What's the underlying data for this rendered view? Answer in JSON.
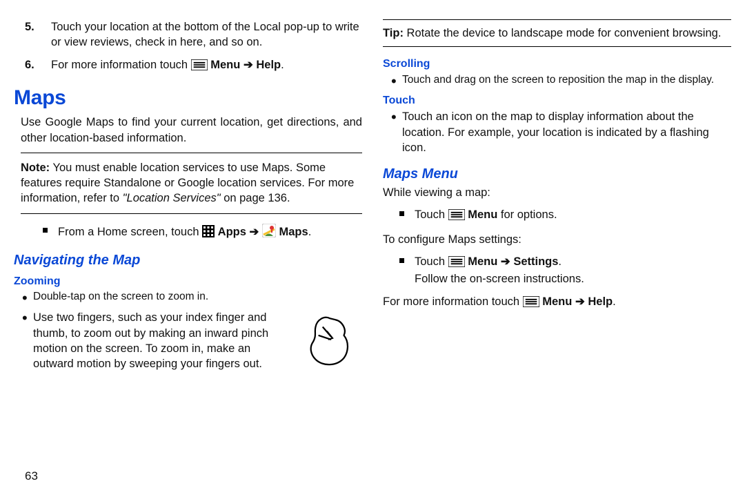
{
  "colL": {
    "step5_num": "5.",
    "step5": "Touch your location at the bottom of the Local pop-up to write or view reviews, check in here, and so on.",
    "step6_num": "6.",
    "step6_pre": "For more information touch ",
    "step6_menu": "Menu",
    "step6_arrow": " ➔ ",
    "step6_help": "Help",
    "step6_period": ".",
    "h1": "Maps",
    "intro": "Use Google Maps to find your current location, get directions, and other location-based information.",
    "note_label": "Note:",
    "note_a": " You must enable location services to use Maps. Some features require Standalone or Google location services. For more information, refer to ",
    "note_ref": "\"Location Services\"",
    "note_b": " on page 136.",
    "home_pre": "From a Home screen, touch ",
    "home_apps": "Apps",
    "home_arrow": " ➔ ",
    "home_maps": "Maps",
    "home_period": ".",
    "h2": "Navigating the Map",
    "zoom_h": "Zooming",
    "zoom_b1": "Double-tap on the screen to zoom in.",
    "zoom_b2": "Use two fingers, such as your index finger and thumb, to zoom out by making an inward pinch motion on the screen. To zoom in, make an outward motion by sweeping your fingers out."
  },
  "colR": {
    "tip_label": "Tip:",
    "tip": " Rotate the device to landscape mode for convenient browsing.",
    "scroll_h": "Scrolling",
    "scroll_b1": "Touch and drag on the screen to reposition the map in the display.",
    "touch_h": "Touch",
    "touch_b1": "Touch an icon on the map to display information about the location. For example, your location is indicated by a flashing icon.",
    "mm_h": "Maps Menu",
    "mm_while": "While viewing a map:",
    "mm_sq1_pre": "Touch ",
    "mm_sq1_menu": "Menu",
    "mm_sq1_post": " for options.",
    "mm_conf": "To configure Maps settings:",
    "mm_sq2_pre": "Touch ",
    "mm_sq2_menu": "Menu",
    "mm_sq2_arrow": " ➔ ",
    "mm_sq2_set": "Settings",
    "mm_sq2_period": ".",
    "mm_sq2_follow": "Follow the on-screen instructions.",
    "mm_more_pre": "For more information touch ",
    "mm_more_menu": "Menu",
    "mm_more_arrow": " ➔ ",
    "mm_more_help": "Help",
    "mm_more_period": "."
  },
  "pagenum": "63"
}
